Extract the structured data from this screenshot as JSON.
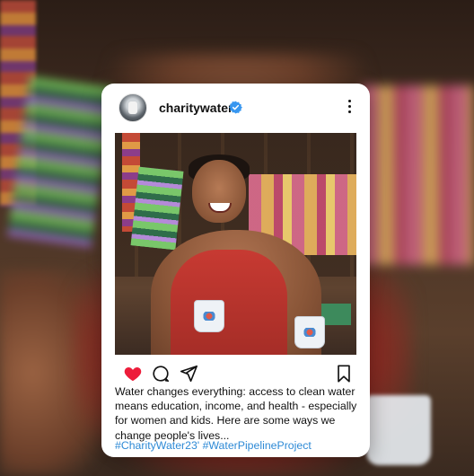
{
  "post": {
    "username": "charitywater",
    "verified": true,
    "caption": "Water changes everything:  access to clean water means education, income, and health - especially for women and kids. Here are some ways we change people's lives...",
    "hashtags": "#CharityWater23' #WaterPipelineProject",
    "liked": true
  },
  "icons": {
    "like": "heart-icon",
    "comment": "comment-icon",
    "share": "send-icon",
    "save": "bookmark-icon",
    "verified": "verified-badge-icon",
    "more": "more-options-icon"
  },
  "colors": {
    "like_red": "#ed1c3a",
    "hashtag_blue": "#2e8ad6",
    "verified_blue": "#3897f0"
  }
}
